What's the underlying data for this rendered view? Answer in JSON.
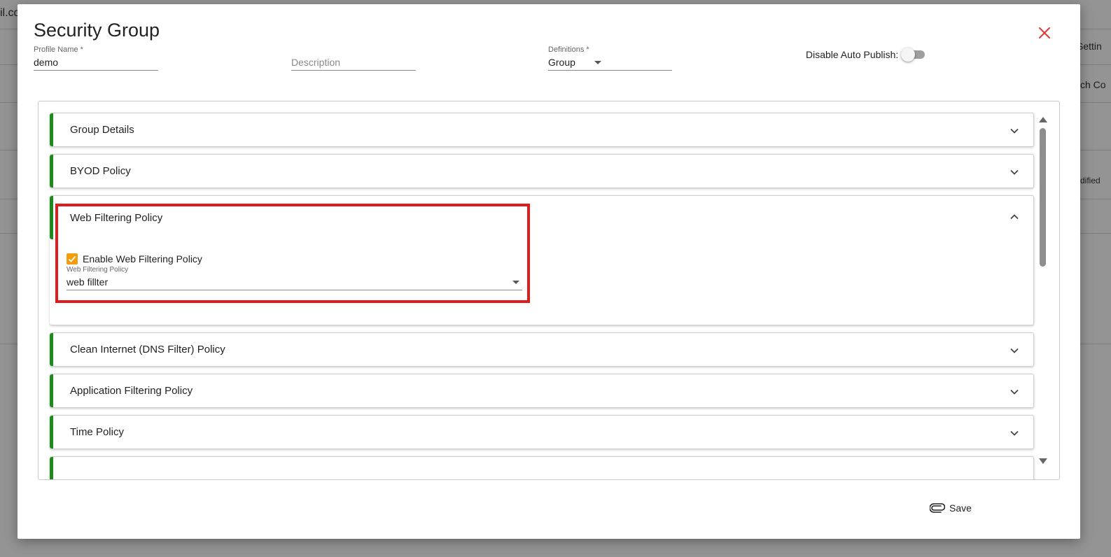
{
  "background": {
    "fragments": [
      "il.co",
      "Settin",
      "ch Co",
      "dified"
    ]
  },
  "modal": {
    "title": "Security Group",
    "close_icon": "close-icon",
    "close_color": "#e53935"
  },
  "fields": {
    "profile_name": {
      "label": "Profile Name *",
      "value": "demo"
    },
    "description": {
      "placeholder": "Description",
      "value": ""
    },
    "definitions": {
      "label": "Definitions *",
      "value": "Group"
    }
  },
  "auto_publish": {
    "label": "Disable Auto Publish:",
    "enabled": false
  },
  "accordion": {
    "accent_color": "#1e8a1e",
    "sections": [
      {
        "title": "Group Details",
        "expanded": false
      },
      {
        "title": "BYOD Policy",
        "expanded": false
      },
      {
        "title": "Web Filtering Policy",
        "expanded": true
      },
      {
        "title": "Clean Internet (DNS Filter) Policy",
        "expanded": false
      },
      {
        "title": "Application Filtering Policy",
        "expanded": false
      },
      {
        "title": "Time Policy",
        "expanded": false
      }
    ]
  },
  "web_filtering": {
    "enable_label": "Enable Web Filtering Policy",
    "enabled": true,
    "policy_label": "Web Filtering Policy",
    "policy_value": "web fillter",
    "highlight_color": "#e01b1b",
    "checkbox_color": "#f59c0b"
  },
  "footer": {
    "save_label": "Save",
    "save_icon": "paperclip-icon"
  }
}
